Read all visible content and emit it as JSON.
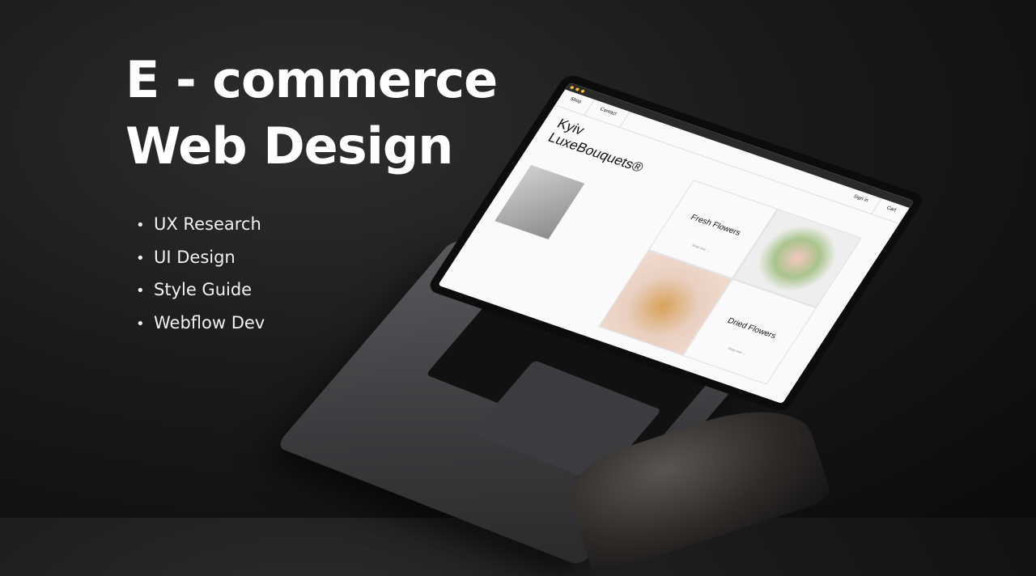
{
  "headline": {
    "line1": "E - commerce",
    "line2": "Web Design"
  },
  "services": [
    "UX Research",
    "UI Design",
    "Style Guide",
    "Webflow Dev"
  ],
  "mockup": {
    "nav": {
      "shop": "Shop",
      "contact": "Contact",
      "signin": "Sign in",
      "cart": "Cart"
    },
    "brand_line1": "Kyiv",
    "brand_line2": "LuxeBouquets®",
    "tile_fresh": "Fresh Flowers",
    "tile_fresh_link": "Shop now →",
    "tile_dried": "Dried Flowers",
    "tile_dried_link": "Shop now →"
  }
}
